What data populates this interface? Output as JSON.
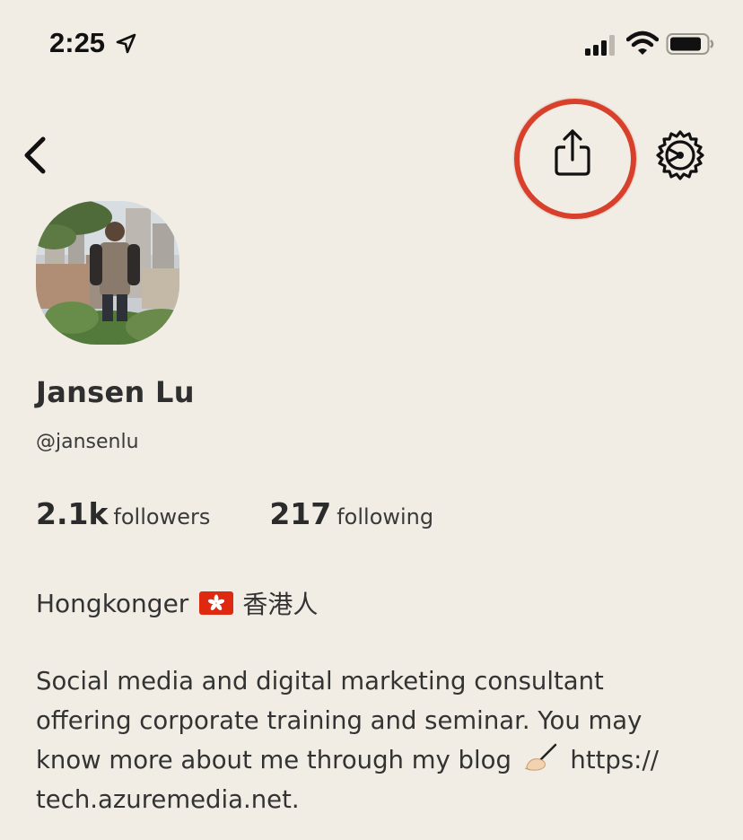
{
  "status_bar": {
    "time": "2:25",
    "icons": [
      "location-arrow-icon",
      "cellular-signal-icon",
      "wifi-icon",
      "battery-icon"
    ]
  },
  "nav": {
    "icons": [
      "back-chevron-icon",
      "share-icon",
      "settings-gear-icon"
    ],
    "highlight_color": "#d8402b"
  },
  "profile": {
    "name": "Jansen Lu",
    "handle": "@jansenlu",
    "followers_count": "2.1k",
    "followers_label": "followers",
    "following_count": "217",
    "following_label": "following"
  },
  "bio": {
    "line1_prefix": "Hongkonger",
    "line1_flag_icon": "hong-kong-flag-icon",
    "line1_suffix": "香港人",
    "para_line1": "Social media and digital marketing consultant",
    "para_line2": "offering corporate training and seminar. You may",
    "para_line3_prefix": "know more about me through my blog",
    "para_line3_icon": "writing-hand-icon",
    "para_line3_link": "https://",
    "para_line4": "tech.azuremedia.net."
  },
  "colors": {
    "background": "#f1ede4",
    "text": "#2b2b2b",
    "accent_ring": "#d8402b"
  }
}
